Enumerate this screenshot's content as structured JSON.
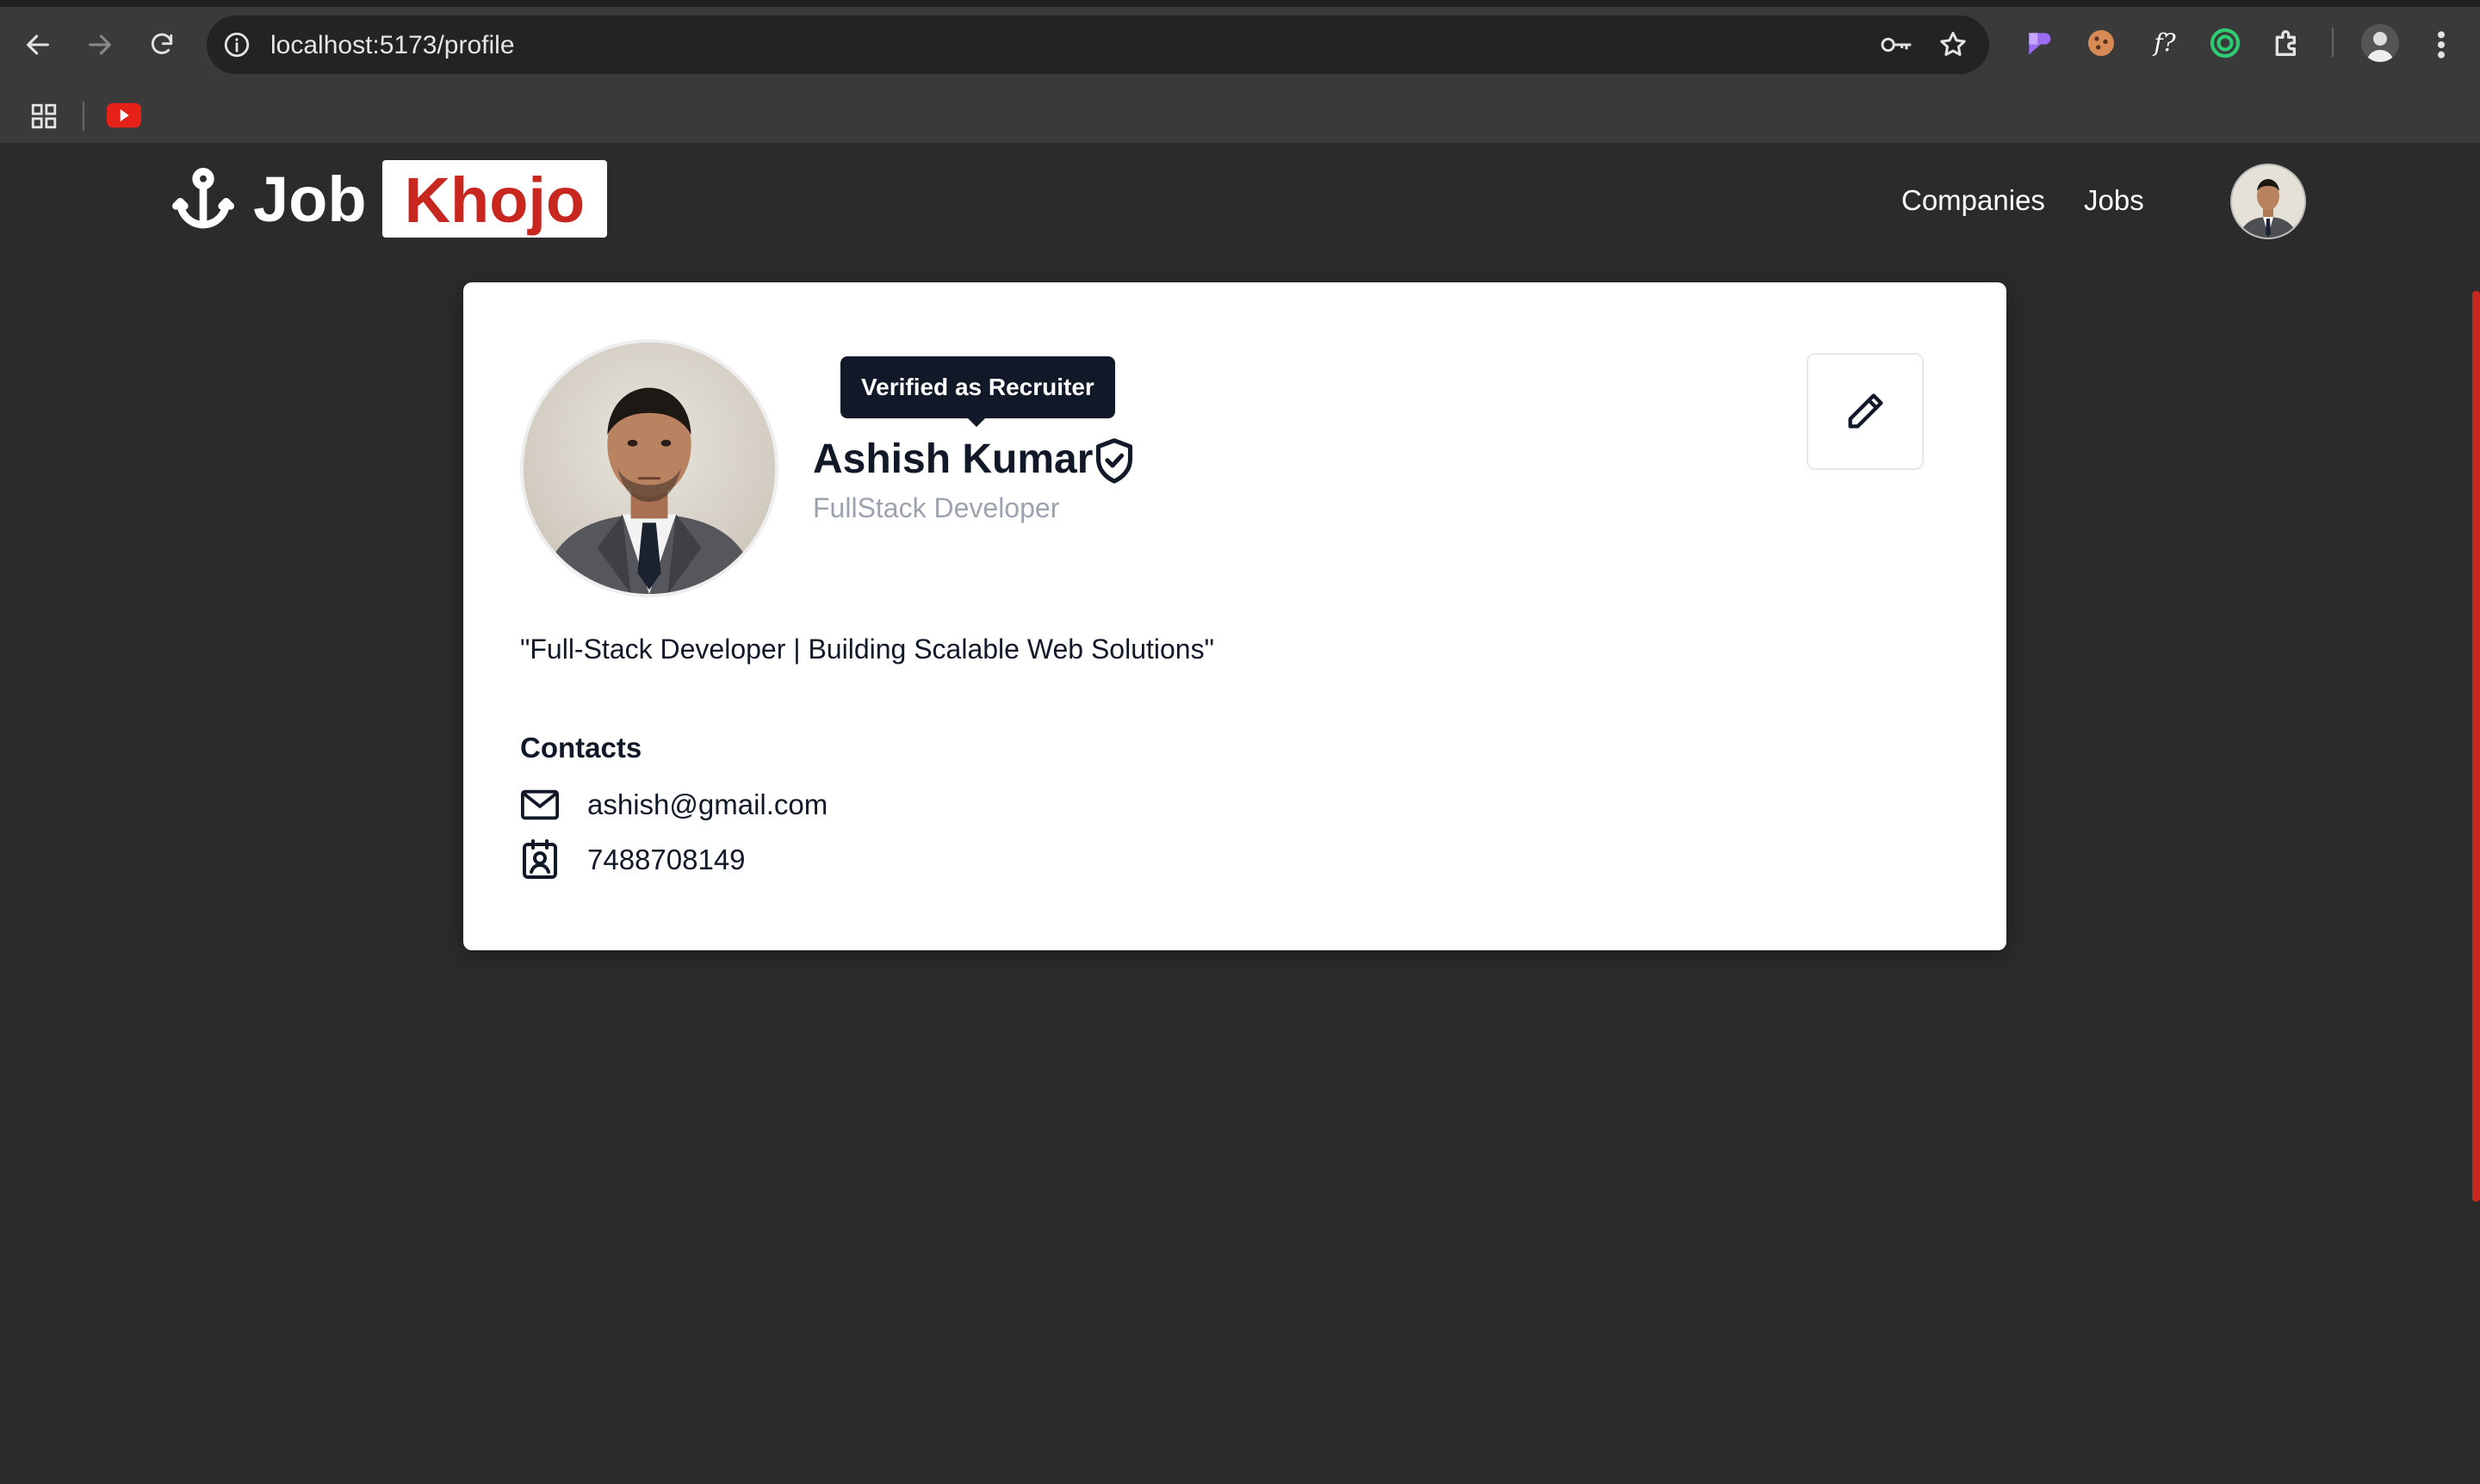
{
  "browser": {
    "url": "localhost:5173/profile"
  },
  "header": {
    "logo_word": "Job",
    "logo_highlight": "Khojo",
    "nav": [
      {
        "label": "Companies"
      },
      {
        "label": "Jobs"
      }
    ]
  },
  "profile": {
    "tooltip": "Verified as Recruiter",
    "name": "Ashish Kumar",
    "role": "FullStack Developer",
    "bio": "\"Full-Stack Developer | Building Scalable Web Solutions\"",
    "contacts_heading": "Contacts",
    "email": "ashish@gmail.com",
    "phone": "7488708149"
  },
  "colors": {
    "brand_red": "#c8271f",
    "page_bg": "#2b2b2c",
    "card_bg": "#ffffff",
    "tooltip_bg": "#111827"
  }
}
